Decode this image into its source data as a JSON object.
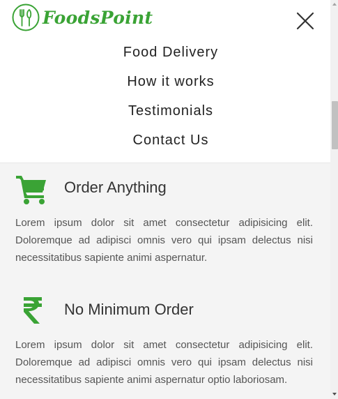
{
  "brand": {
    "name": "FoodsPoint",
    "color": "#3aa335"
  },
  "menu": {
    "items": [
      {
        "label": "Food Delivery"
      },
      {
        "label": "How it works"
      },
      {
        "label": "Testimonials"
      },
      {
        "label": "Contact Us"
      }
    ],
    "close_icon": "close-icon"
  },
  "features": [
    {
      "icon": "cart-icon",
      "title": "Order Anything",
      "text": "Lorem ipsum dolor sit amet consectetur adipisicing elit. Doloremque ad adipisci omnis vero qui ipsam delectus nisi necessitatibus sapiente animi aspernatur."
    },
    {
      "icon": "rupee-icon",
      "title": "No Minimum Order",
      "text": "Lorem ipsum dolor sit amet consectetur adipisicing elit. Doloremque ad adipisci omnis vero qui ipsam delectus nisi necessitatibus sapiente animi aspernatur optio laboriosam."
    }
  ],
  "colors": {
    "accent": "#3aa335",
    "background": "#f4f4f4",
    "header": "#ffffff"
  }
}
